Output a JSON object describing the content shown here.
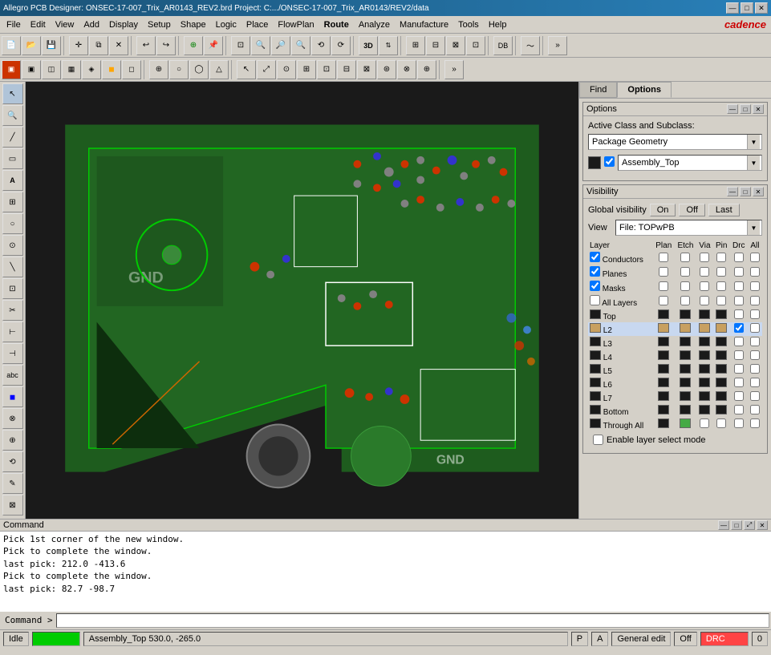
{
  "titleBar": {
    "text": "Allegro PCB Designer: ONSEC-17-007_Trix_AR0143_REV2.brd  Project: C:.../ONSEC-17-007_Trix_AR0143/REV2/data",
    "minimizeBtn": "—",
    "maximizeBtn": "□",
    "closeBtn": "✕"
  },
  "menuBar": {
    "items": [
      "File",
      "Edit",
      "View",
      "Add",
      "Display",
      "Setup",
      "Shape",
      "Logic",
      "Place",
      "FlowPlan",
      "Route",
      "Analyze",
      "Manufacture",
      "Tools",
      "Help"
    ],
    "logo": "cadence"
  },
  "panelTabs": {
    "find": "Find",
    "options": "Options"
  },
  "optionsPanel": {
    "title": "Options",
    "activeClass": {
      "label": "Active Class and Subclass:",
      "classValue": "Package Geometry",
      "subclassValue": "Assembly_Top"
    }
  },
  "visibilityPanel": {
    "title": "Visibility",
    "globalVisLabel": "Global visibility",
    "onBtn": "On",
    "offBtn": "Off",
    "lastBtn": "Last",
    "viewLabel": "View",
    "viewValue": "File: TOPwPB",
    "columns": {
      "layer": "Layer",
      "plan": "Plan",
      "etch": "Etch",
      "via": "Via",
      "pin": "Pin",
      "drc": "Drc",
      "all": "All"
    },
    "categoryRows": [
      {
        "name": "Conductors",
        "checked": true,
        "plan": false,
        "etch": false,
        "via": false,
        "pin": false,
        "drc": false,
        "all": false
      },
      {
        "name": "Planes",
        "checked": true,
        "plan": false,
        "etch": false,
        "via": false,
        "pin": false,
        "drc": false,
        "all": false
      },
      {
        "name": "Masks",
        "checked": true,
        "plan": false,
        "etch": false,
        "via": false,
        "pin": false,
        "drc": false,
        "all": false
      },
      {
        "name": "All Layers",
        "checked": false,
        "plan": false,
        "etch": false,
        "via": false,
        "pin": false,
        "drc": false,
        "all": false
      }
    ],
    "layerRows": [
      {
        "name": "Top",
        "color": "#1a1a1a",
        "plan": true,
        "etch": true,
        "via": true,
        "pin": true,
        "drc": false,
        "all": false,
        "highlight": false
      },
      {
        "name": "L2",
        "color": "#c8a060",
        "plan": true,
        "etch": true,
        "via": true,
        "pin": true,
        "drc": true,
        "all": false,
        "highlight": true
      },
      {
        "name": "L3",
        "color": "#1a1a1a",
        "plan": true,
        "etch": true,
        "via": true,
        "pin": true,
        "drc": false,
        "all": false,
        "highlight": false
      },
      {
        "name": "L4",
        "color": "#1a1a1a",
        "plan": true,
        "etch": true,
        "via": true,
        "pin": true,
        "drc": false,
        "all": false,
        "highlight": false
      },
      {
        "name": "L5",
        "color": "#1a1a1a",
        "plan": true,
        "etch": true,
        "via": true,
        "pin": true,
        "drc": false,
        "all": false,
        "highlight": false
      },
      {
        "name": "L6",
        "color": "#1a1a1a",
        "plan": true,
        "etch": true,
        "via": true,
        "pin": true,
        "drc": false,
        "all": false,
        "highlight": false
      },
      {
        "name": "L7",
        "color": "#1a1a1a",
        "plan": true,
        "etch": true,
        "via": true,
        "pin": true,
        "drc": false,
        "all": false,
        "highlight": false
      },
      {
        "name": "Bottom",
        "color": "#1a1a1a",
        "plan": true,
        "etch": true,
        "via": true,
        "pin": true,
        "drc": false,
        "all": false,
        "highlight": false
      },
      {
        "name": "Through All",
        "color": "#1a1a1a",
        "plan": true,
        "etch": false,
        "via": false,
        "pin": false,
        "drc": false,
        "all": false,
        "highlight": false
      }
    ],
    "enableLayerSelect": "Enable layer select mode"
  },
  "commandArea": {
    "title": "Command",
    "lines": [
      "Pick 1st corner of the new window.",
      "Pick to complete the window.",
      "last pick:  212.0 -413.6",
      "Pick to complete the window.",
      "last pick:  82.7 -98.7"
    ],
    "prompt": "Command >"
  },
  "statusBar": {
    "idle": "Idle",
    "greenStatus": "",
    "coordsLabel": "Assembly_Top  530.0, -265.0",
    "padBtn": "P",
    "apsBtn": "A",
    "generalEdit": "General edit",
    "offLabel": "Off",
    "drcLabel": "DRC",
    "drcValue": "0"
  }
}
